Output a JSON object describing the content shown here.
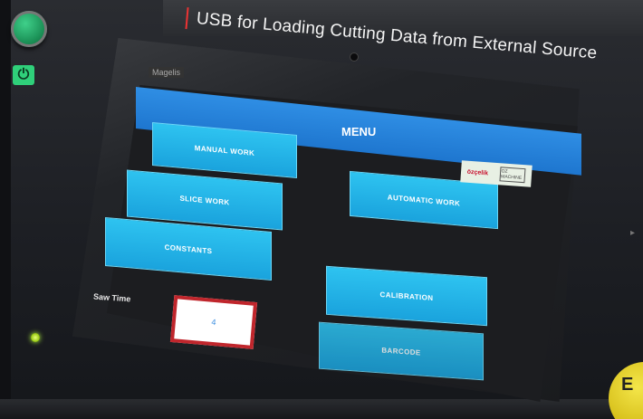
{
  "banner": {
    "text": "USB for Loading Cutting Data from External Source"
  },
  "hmi_brand": "Magelis",
  "screen": {
    "title": "MENU",
    "buttons": {
      "manual_work": "MANUAL WORK",
      "slice_work": "SLICE WORK",
      "constants": "CONSTANTS",
      "automatic_work": "AUTOMATIC WORK",
      "calibration": "CALIBRATION",
      "barcode": "BARCODE"
    },
    "logo": {
      "brand": "özçelik",
      "secondary": "OZ MACHINE"
    },
    "saw_time": {
      "label": "Saw Time",
      "value": "4"
    }
  },
  "hardware": {
    "power_symbol": "⏻",
    "emergency_label": "E"
  },
  "colors": {
    "title_bar": "#1e76cf",
    "menu_button": "#1aa3dd",
    "field_border": "#c0262c",
    "status_led": "#b8ff44"
  },
  "icons": [
    "power-icon",
    "status-led-icon",
    "camera-icon"
  ]
}
